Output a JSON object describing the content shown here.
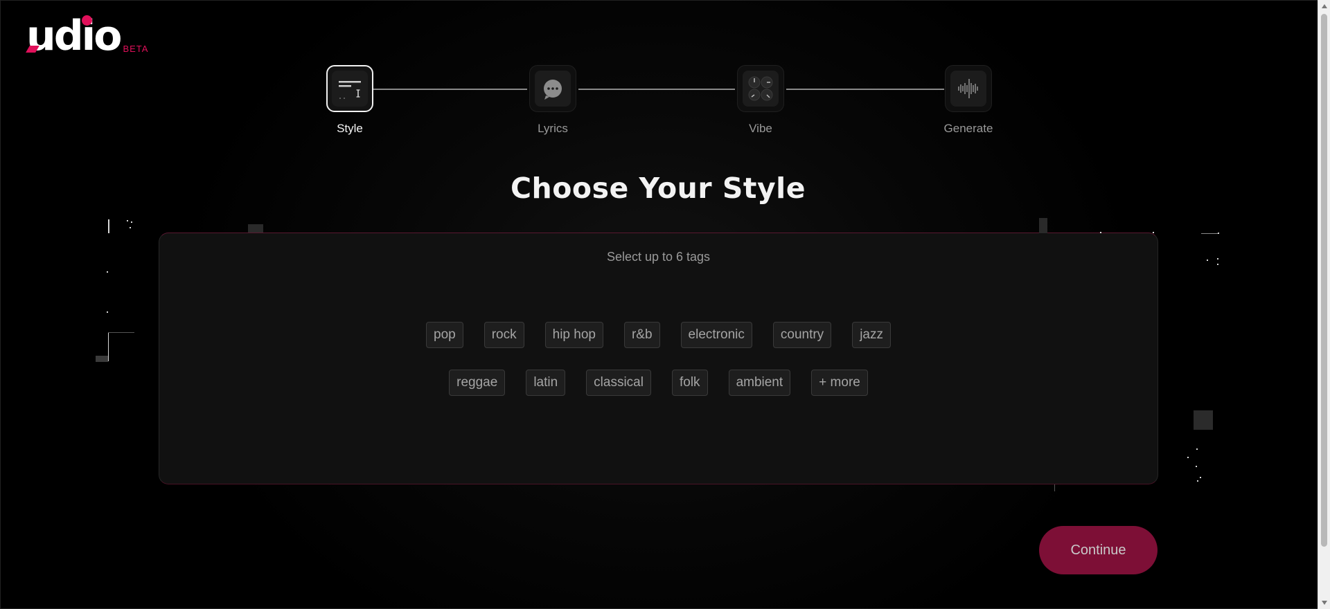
{
  "logo": {
    "word": "udio",
    "badge": "BETA"
  },
  "steps": [
    {
      "label": "Style",
      "active": true,
      "icon": "text-lines-icon"
    },
    {
      "label": "Lyrics",
      "active": false,
      "icon": "chat-bubble-icon"
    },
    {
      "label": "Vibe",
      "active": false,
      "icon": "knobs-icon"
    },
    {
      "label": "Generate",
      "active": false,
      "icon": "waveform-icon"
    }
  ],
  "title": "Choose Your Style",
  "panel": {
    "subtitle": "Select up to 6 tags",
    "tags_row1": [
      "pop",
      "rock",
      "hip hop",
      "r&b",
      "electronic",
      "country",
      "jazz"
    ],
    "tags_row2": [
      "reggae",
      "latin",
      "classical",
      "folk",
      "ambient",
      "+ more"
    ]
  },
  "continue_label": "Continue",
  "colors": {
    "accent": "#e0105a",
    "continue_bg": "#7d0f36",
    "panel_bg": "#111111"
  }
}
